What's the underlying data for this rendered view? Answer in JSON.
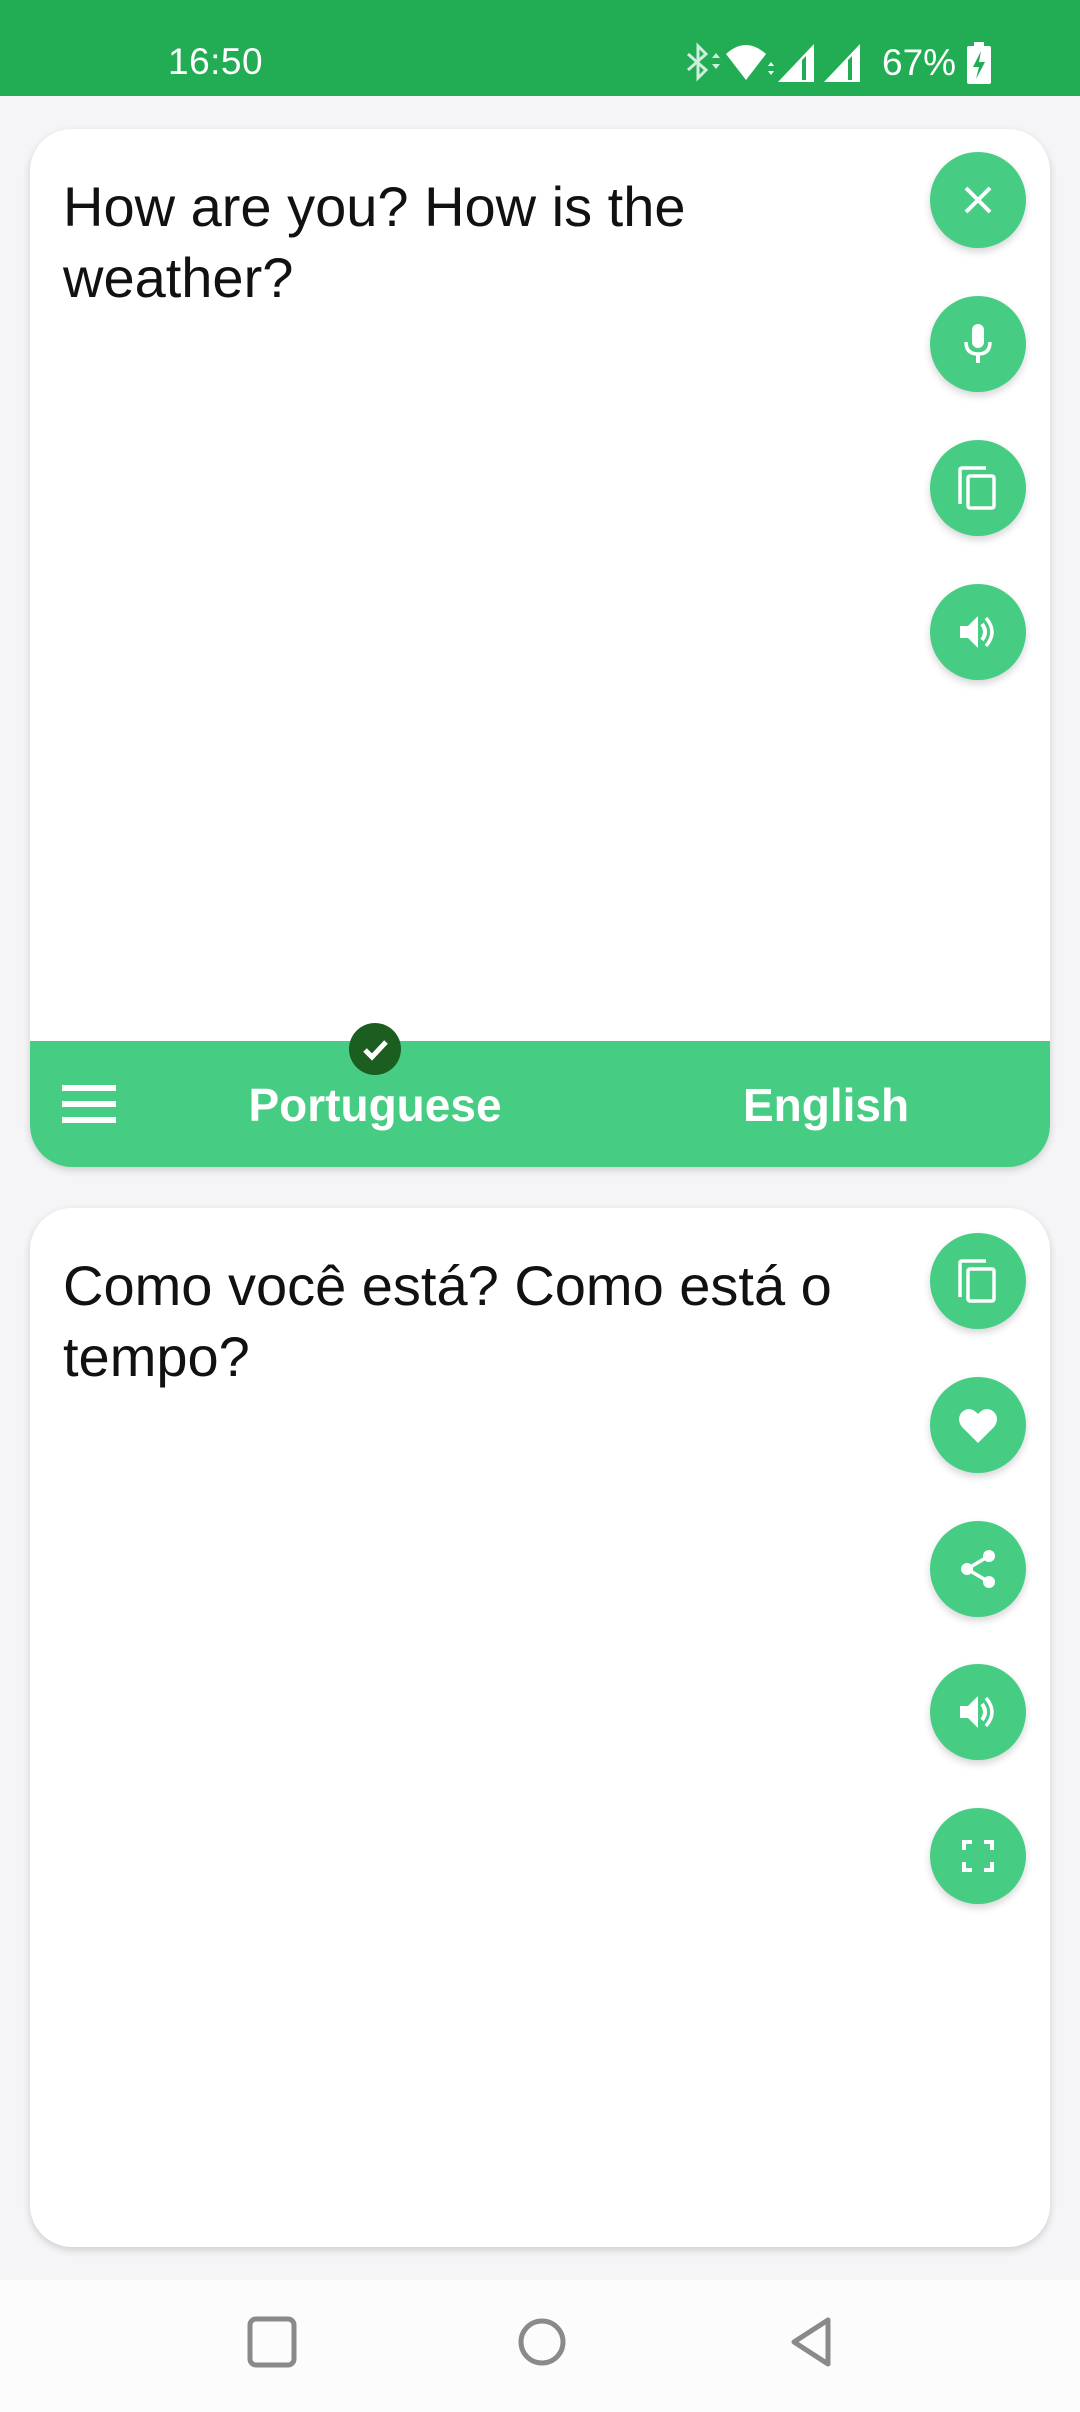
{
  "status_bar": {
    "time": "16:50",
    "battery_percent": "67%",
    "icons": [
      "bluetooth-icon",
      "wifi-icon",
      "signal-icon",
      "signal-icon",
      "battery-charging-icon"
    ]
  },
  "source_panel": {
    "text": "How are you? How is the weather?",
    "actions": [
      {
        "name": "clear",
        "icon": "close-icon"
      },
      {
        "name": "voice-input",
        "icon": "microphone-icon"
      },
      {
        "name": "copy",
        "icon": "copy-icon"
      },
      {
        "name": "speak",
        "icon": "speaker-icon"
      }
    ]
  },
  "language_bar": {
    "menu_icon": "hamburger-menu-icon",
    "source_language": "Portuguese",
    "target_language": "English",
    "selected_indicator": "check-icon"
  },
  "result_panel": {
    "text": "Como você está? Como está o tempo?",
    "actions": [
      {
        "name": "copy",
        "icon": "copy-icon"
      },
      {
        "name": "favorite",
        "icon": "heart-icon"
      },
      {
        "name": "share",
        "icon": "share-icon"
      },
      {
        "name": "speak",
        "icon": "speaker-icon"
      },
      {
        "name": "fullscreen",
        "icon": "fullscreen-icon"
      }
    ]
  },
  "nav_bar": {
    "buttons": [
      "recents",
      "home",
      "back"
    ]
  },
  "colors": {
    "status_bar": "#22ad55",
    "accent": "#47cc84",
    "check_badge": "#1b5e20",
    "background": "#f5f5f7"
  }
}
